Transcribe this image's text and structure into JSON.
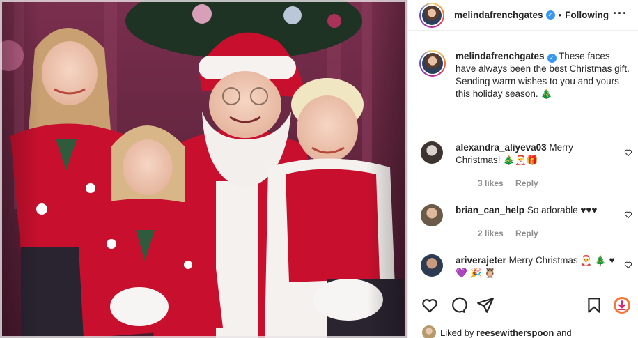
{
  "post": {
    "username": "melindafrenchgates",
    "verified_icon": "verified-badge-icon",
    "separator": "•",
    "follow_status": "Following",
    "more_icon": "more-options-icon",
    "caption_text": "These faces have always been the best Christmas gift. Sending warm wishes to you and yours this holiday season. 🎄"
  },
  "comments": [
    {
      "username": "alexandra_aliyeva03",
      "text": "Merry Christmas! 🎄🎅🎁",
      "likes": "3 likes",
      "reply": "Reply"
    },
    {
      "username": "brian_can_help",
      "text": "So adorable ♥♥♥",
      "likes": "2 likes",
      "reply": "Reply"
    },
    {
      "username": "ariverajeter",
      "text": "Merry Christmas 🎅 🎄 ♥ 💜 🎉 🦉"
    }
  ],
  "actions": {
    "like_icon": "heart-icon",
    "comment_icon": "comment-icon",
    "share_icon": "share-icon",
    "save_icon": "bookmark-icon",
    "download_icon": "download-icon"
  },
  "likes": {
    "prefix": "Liked by",
    "user": "reesewitherspoon",
    "suffix": "and"
  },
  "colors": {
    "accent_blue": "#3897f0",
    "text": "#262626",
    "muted": "#8e8e8e",
    "santa_red": "#c8102e",
    "backdrop_purple": "#6b2a44"
  }
}
